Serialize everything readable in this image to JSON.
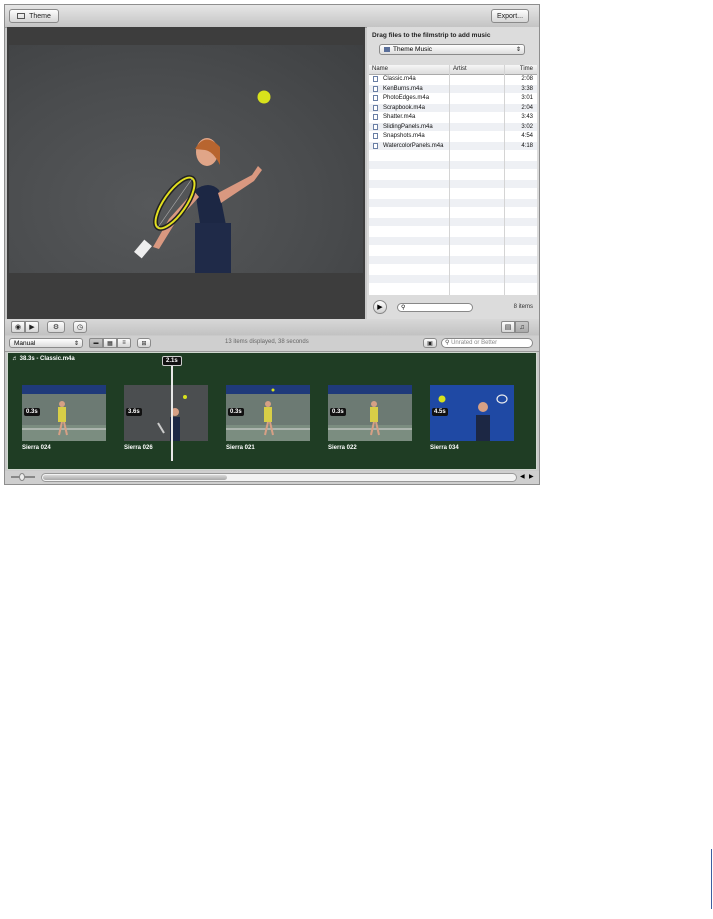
{
  "topbar": {
    "theme_label": "Theme",
    "export_label": "Export..."
  },
  "music": {
    "heading": "Drag files to the filmstrip to add music",
    "source_selected": "Theme Music",
    "columns": {
      "name": "Name",
      "artist": "Artist",
      "time": "Time"
    },
    "tracks": [
      {
        "name": "Classic.m4a",
        "time": "2:08"
      },
      {
        "name": "KenBurns.m4a",
        "time": "3:38"
      },
      {
        "name": "PhotoEdges.m4a",
        "time": "3:01"
      },
      {
        "name": "Scrapbook.m4a",
        "time": "2:04"
      },
      {
        "name": "Shatter.m4a",
        "time": "3:43"
      },
      {
        "name": "SlidingPanels.m4a",
        "time": "3:02"
      },
      {
        "name": "Snapshots.m4a",
        "time": "4:54"
      },
      {
        "name": "WatercolorPanels.m4a",
        "time": "4:18"
      }
    ],
    "count": "8 items"
  },
  "toolbar": {
    "sort_selected": "Manual",
    "status": "13 items displayed, 38 seconds",
    "rating_filter_placeholder": "Unrated or Better"
  },
  "filmstrip": {
    "audio_label": "38.3s - Classic.m4a",
    "playhead_time": "2.1s",
    "clips": [
      {
        "name": "Sierra 024",
        "duration": "0.3s"
      },
      {
        "name": "Sierra 026",
        "duration": "3.6s"
      },
      {
        "name": "Sierra 021",
        "duration": "0.3s"
      },
      {
        "name": "Sierra 022",
        "duration": "0.3s"
      },
      {
        "name": "Sierra 034",
        "duration": "4.5s"
      }
    ]
  },
  "colors": {
    "filmstrip_bg": "#1f3d24",
    "viewer_bg": "#3d3d3d",
    "ball": "#d8e21c"
  }
}
